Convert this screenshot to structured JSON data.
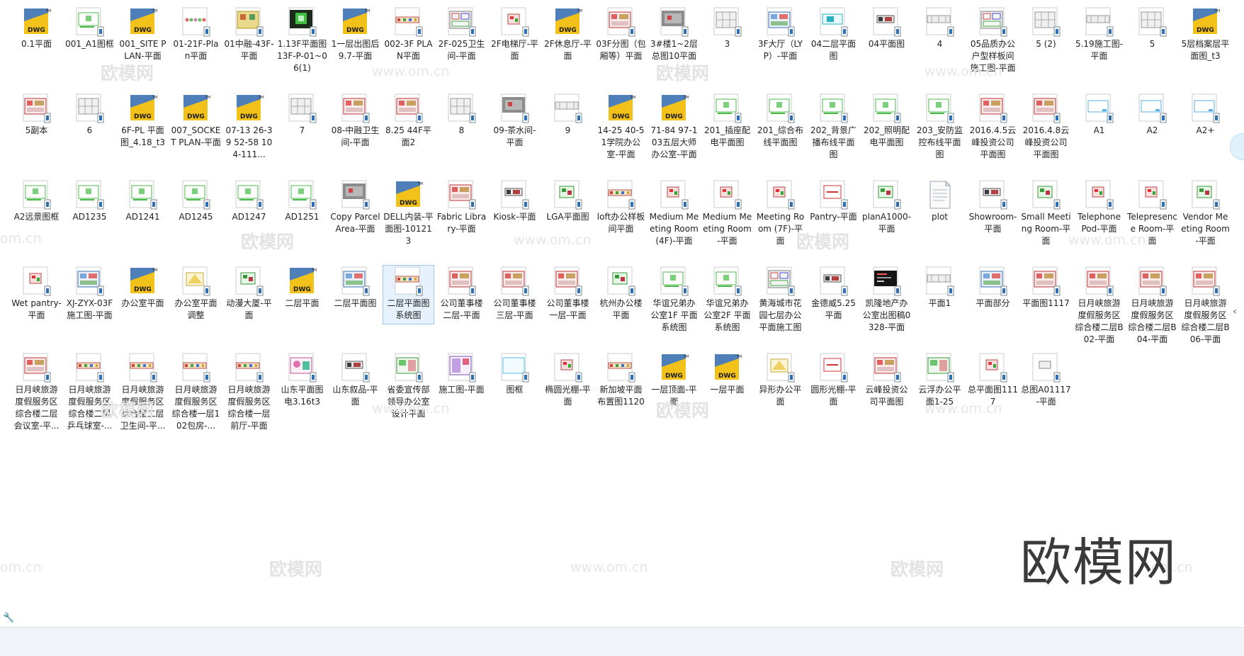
{
  "files": [
    {
      "label": "0.1平面",
      "thumb": "dwg"
    },
    {
      "label": "001_A1图框",
      "thumb": "frame-green"
    },
    {
      "label": "001_SITE PLAN-平面",
      "thumb": "dwg"
    },
    {
      "label": "01-21F-Plan平面",
      "thumb": "dots"
    },
    {
      "label": "01中融-43F-平面",
      "thumb": "floorplan-yellow"
    },
    {
      "label": "1.13F平面图13F-P-01~06(1)",
      "thumb": "dark-green"
    },
    {
      "label": "1一层出图后9.7-平面",
      "thumb": "dwg"
    },
    {
      "label": "002-3F PLAN平面",
      "thumb": "line-colored"
    },
    {
      "label": "2F-025卫生间-平面",
      "thumb": "floorplan"
    },
    {
      "label": "2F电梯厅-平面",
      "thumb": "small-red"
    },
    {
      "label": "2F休息厅-平面",
      "thumb": "dwg"
    },
    {
      "label": "03F分图（包厢等）平面",
      "thumb": "floorplan-red"
    },
    {
      "label": "3#楼1~2层总图10平面",
      "thumb": "gray-block"
    },
    {
      "label": "3",
      "thumb": "grid-gray"
    },
    {
      "label": "3F大厅（LYP）-平面",
      "thumb": "floorplan-blue"
    },
    {
      "label": "04二层平面图",
      "thumb": "cyan-box"
    },
    {
      "label": "04平面图",
      "thumb": "small-dark"
    },
    {
      "label": "4",
      "thumb": "wide-gray"
    },
    {
      "label": "05品质办公户型样板间施工图-平面",
      "thumb": "floorplan"
    },
    {
      "label": "5 (2)",
      "thumb": "grid-gray"
    },
    {
      "label": "5.19施工图-平面",
      "thumb": "wide-gray"
    },
    {
      "label": "5",
      "thumb": "grid-gray"
    },
    {
      "label": "5层档案层平面图_t3",
      "thumb": "dwg"
    },
    {
      "label": "5副本",
      "thumb": "floorplan-red"
    },
    {
      "label": "6",
      "thumb": "grid-gray"
    },
    {
      "label": "6F-PL 平面图_4.18_t3",
      "thumb": "dwg"
    },
    {
      "label": "007_SOCKET PLAN-平面",
      "thumb": "dwg"
    },
    {
      "label": "07-13 26-39 52-58 104-111...",
      "thumb": "dwg"
    },
    {
      "label": "7",
      "thumb": "grid-gray"
    },
    {
      "label": "08-中融卫生间-平面",
      "thumb": "floorplan-red"
    },
    {
      "label": "8.25 44F平面2",
      "thumb": "floorplan-red"
    },
    {
      "label": "8",
      "thumb": "grid-gray"
    },
    {
      "label": "09-茶水间-平面",
      "thumb": "gray-block"
    },
    {
      "label": "9",
      "thumb": "wide-gray"
    },
    {
      "label": "14-25 40-51学院办公室-平面",
      "thumb": "dwg"
    },
    {
      "label": "71-84 97-103五层大师办公室-平面",
      "thumb": "dwg"
    },
    {
      "label": "201_插座配电平面图",
      "thumb": "frame-green"
    },
    {
      "label": "201_综合布线平面图",
      "thumb": "frame-green"
    },
    {
      "label": "202_背景广播布线平面图",
      "thumb": "frame-green"
    },
    {
      "label": "202_照明配电平面图",
      "thumb": "frame-green"
    },
    {
      "label": "203_安防监控布线平面图",
      "thumb": "frame-green"
    },
    {
      "label": "2016.4.5云峰投资公司平面图",
      "thumb": "floorplan-red"
    },
    {
      "label": "2016.4.8云峰投资公司平面图",
      "thumb": "floorplan-red"
    },
    {
      "label": "A1",
      "thumb": "frame-blue"
    },
    {
      "label": "A2",
      "thumb": "frame-blue"
    },
    {
      "label": "A2+",
      "thumb": "frame-blue"
    },
    {
      "label": "A2远景图框",
      "thumb": "frame-green"
    },
    {
      "label": "AD1235",
      "thumb": "frame-green"
    },
    {
      "label": "AD1241",
      "thumb": "frame-green"
    },
    {
      "label": "AD1245",
      "thumb": "frame-green"
    },
    {
      "label": "AD1247",
      "thumb": "frame-green"
    },
    {
      "label": "AD1251",
      "thumb": "frame-green"
    },
    {
      "label": "Copy Parcel Area-平面",
      "thumb": "gray-block"
    },
    {
      "label": "DELL内装-平面图-101213",
      "thumb": "dwg"
    },
    {
      "label": "Fabric Library-平面",
      "thumb": "floorplan-red"
    },
    {
      "label": "Kiosk-平面",
      "thumb": "small-dark"
    },
    {
      "label": "LGA平面图",
      "thumb": "small-green"
    },
    {
      "label": "loft办公样板间平面",
      "thumb": "line-colored"
    },
    {
      "label": "Medium Meeting Room(4F)-平面",
      "thumb": "small-red"
    },
    {
      "label": "Medium Meeting Room-平面",
      "thumb": "small-red"
    },
    {
      "label": "Meeting Room (7F)-平面",
      "thumb": "small-red"
    },
    {
      "label": "Pantry-平面",
      "thumb": "red-box"
    },
    {
      "label": "planA1000-平面",
      "thumb": "small-green"
    },
    {
      "label": "plot",
      "thumb": "doc"
    },
    {
      "label": "Showroom-平面",
      "thumb": "small-dark"
    },
    {
      "label": "Small Meeting Room-平面",
      "thumb": "small-green"
    },
    {
      "label": "Telephone Pod-平面",
      "thumb": "small-red"
    },
    {
      "label": "Telepresence Room-平面",
      "thumb": "small-red"
    },
    {
      "label": "Vendor Meeting Room-平面",
      "thumb": "small-green"
    },
    {
      "label": "Wet pantry-平面",
      "thumb": "small-red"
    },
    {
      "label": "XJ-ZYX-03F施工图-平面",
      "thumb": "floorplan-blue"
    },
    {
      "label": "办公室平面",
      "thumb": "dwg"
    },
    {
      "label": "办公室平面调整",
      "thumb": "small-yellow"
    },
    {
      "label": "动漫大厦-平面",
      "thumb": "small-green"
    },
    {
      "label": "二层平面",
      "thumb": "dwg"
    },
    {
      "label": "二层平面图",
      "thumb": "floorplan-blue"
    },
    {
      "label": "二层平面图系统图",
      "thumb": "line-colored",
      "selected": true
    },
    {
      "label": "公司董事楼二层-平面",
      "thumb": "floorplan-red"
    },
    {
      "label": "公司董事楼三层-平面",
      "thumb": "floorplan-red"
    },
    {
      "label": "公司董事楼一层-平面",
      "thumb": "floorplan-red"
    },
    {
      "label": "杭州办公楼平面",
      "thumb": "small-green"
    },
    {
      "label": "华谊兄弟办公室1F 平面系统图",
      "thumb": "frame-green"
    },
    {
      "label": "华谊兄弟办公室2F 平面系统图",
      "thumb": "frame-green"
    },
    {
      "label": "黄海城市花园七层办公平面施工图",
      "thumb": "floorplan"
    },
    {
      "label": "金德威5.25平面",
      "thumb": "small-dark"
    },
    {
      "label": "凯隆地产办公室出图稿0328-平面",
      "thumb": "black"
    },
    {
      "label": "平面1",
      "thumb": "wide-gray"
    },
    {
      "label": "平面部分",
      "thumb": "floorplan-blue"
    },
    {
      "label": "平面图1117",
      "thumb": "floorplan-red"
    },
    {
      "label": "日月峡旅游度假服务区综合楼二层B02-平面",
      "thumb": "floorplan-red"
    },
    {
      "label": "日月峡旅游度假服务区综合楼二层B04-平面",
      "thumb": "floorplan-red"
    },
    {
      "label": "日月峡旅游度假服务区综合楼二层B06-平面",
      "thumb": "floorplan-red"
    },
    {
      "label": "日月峡旅游度假服务区综合楼二层会议室-平...",
      "thumb": "floorplan-red"
    },
    {
      "label": "日月峡旅游度假服务区综合楼二层乒乓球室-...",
      "thumb": "line-colored"
    },
    {
      "label": "日月峡旅游度假服务区综合楼二层卫生间-平...",
      "thumb": "line-colored"
    },
    {
      "label": "日月峡旅游度假服务区综合楼一层102包房-...",
      "thumb": "line-colored"
    },
    {
      "label": "日月峡旅游度假服务区综合楼一层前厅-平面",
      "thumb": "line-colored"
    },
    {
      "label": "山东平面图电3.16t3",
      "thumb": "floorplan-pink"
    },
    {
      "label": "山东叙品-平面",
      "thumb": "small-dark"
    },
    {
      "label": "省委宣传部领导办公室设计平面",
      "thumb": "floorplan-green"
    },
    {
      "label": "施工图-平面",
      "thumb": "floorplan-purple"
    },
    {
      "label": "图框",
      "thumb": "frame-cyan"
    },
    {
      "label": "椭圆光棚-平面",
      "thumb": "small-red"
    },
    {
      "label": "新加坡平面布置图1120",
      "thumb": "line-colored"
    },
    {
      "label": "一层顶面-平面",
      "thumb": "dwg"
    },
    {
      "label": "一层平面",
      "thumb": "dwg"
    },
    {
      "label": "异形办公平面",
      "thumb": "small-yellow"
    },
    {
      "label": "圆形光棚-平面",
      "thumb": "red-box"
    },
    {
      "label": "云峰投资公司平面图",
      "thumb": "floorplan-red"
    },
    {
      "label": "云浮办公平面1-25",
      "thumb": "floorplan-green"
    },
    {
      "label": "总平面图1117",
      "thumb": "small-red"
    },
    {
      "label": "总图A01117-平面",
      "thumb": "small-gray"
    }
  ],
  "watermarks": {
    "logo_text": "欧模网",
    "url_text": "www.om.cn",
    "url_short": "om.cn"
  },
  "brand_text": "欧模网",
  "dwg_text": "DWG",
  "tm_text": "TM",
  "scroll_glyph": "‹",
  "status_icon_glyph": "🔧"
}
